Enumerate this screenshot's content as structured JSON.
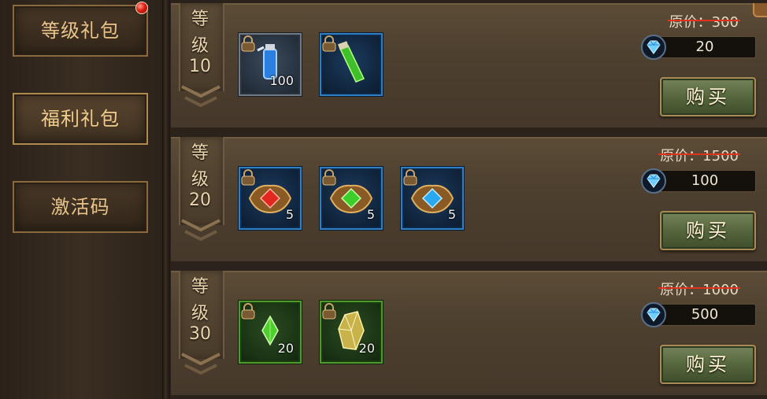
{
  "sidebar": {
    "items": [
      {
        "label": "等级礼包",
        "has_dot": true
      },
      {
        "label": "福利礼包",
        "active": true
      },
      {
        "label": "激活码"
      }
    ]
  },
  "packs": [
    {
      "rank_t1": "等",
      "rank_t2": "级",
      "rank_num": "10",
      "original_price": "原价：300",
      "price": "20",
      "buy_label": "购买",
      "items": [
        {
          "icon": "blue-potion-icon",
          "qty": "100",
          "frame": "gray"
        },
        {
          "icon": "green-potion-icon",
          "qty": "",
          "frame": "blue"
        }
      ]
    },
    {
      "rank_t1": "等",
      "rank_t2": "级",
      "rank_num": "20",
      "original_price": "原价：1500",
      "price": "100",
      "buy_label": "购买",
      "items": [
        {
          "icon": "red-gem-emblem-icon",
          "qty": "5",
          "frame": "blue"
        },
        {
          "icon": "green-gem-emblem-icon",
          "qty": "5",
          "frame": "blue"
        },
        {
          "icon": "blue-gem-emblem-icon",
          "qty": "5",
          "frame": "blue"
        }
      ]
    },
    {
      "rank_t1": "等",
      "rank_t2": "级",
      "rank_num": "30",
      "original_price": "原价：1000",
      "price": "500",
      "buy_label": "购买",
      "items": [
        {
          "icon": "green-crystal-icon",
          "qty": "20",
          "frame": "green"
        },
        {
          "icon": "yellow-crystal-icon",
          "qty": "20",
          "frame": "green"
        }
      ]
    }
  ]
}
